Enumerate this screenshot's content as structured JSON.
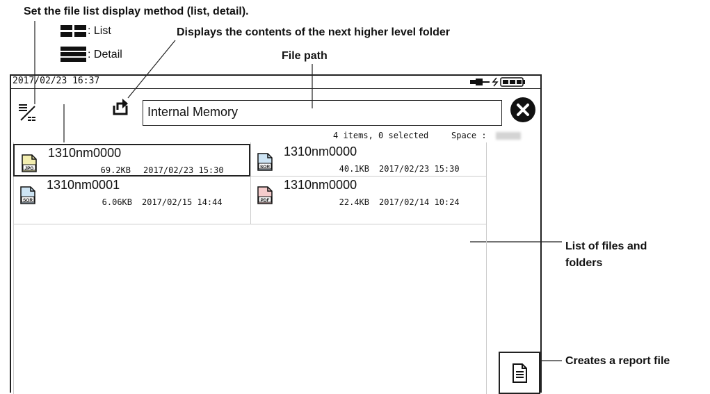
{
  "callouts": {
    "display_method": "Set the file list display method (list, detail).",
    "list_legend": ": List",
    "detail_legend": ": Detail",
    "parent_folder": "Displays the contents of the next higher level folder",
    "file_path": "File path",
    "file_list_line1": "List of files and",
    "file_list_line2": "folders",
    "report_file": "Creates a report file"
  },
  "status_bar": {
    "datetime": "2017/02/23 16:37"
  },
  "toolbar": {
    "path_value": "Internal Memory"
  },
  "info_bar": {
    "items_text": "4 items, 0 selected",
    "space_label": "Space :"
  },
  "files": [
    {
      "name": "1310nm0000",
      "size": "69.2KB",
      "date": "2017/02/23 15:30",
      "type": "JPG",
      "icon_color": "#f3eeb0",
      "selected": true
    },
    {
      "name": "1310nm0000",
      "size": "40.1KB",
      "date": "2017/02/23 15:30",
      "type": "SOR",
      "icon_color": "#cde4f4",
      "selected": false
    },
    {
      "name": "1310nm0001",
      "size": "6.06KB",
      "date": "2017/02/15 14:44",
      "type": "SOR",
      "icon_color": "#cde4f4",
      "selected": false
    },
    {
      "name": "1310nm0000",
      "size": "22.4KB",
      "date": "2017/02/14 10:24",
      "type": "PDF",
      "icon_color": "#f6cccc",
      "selected": false
    }
  ]
}
